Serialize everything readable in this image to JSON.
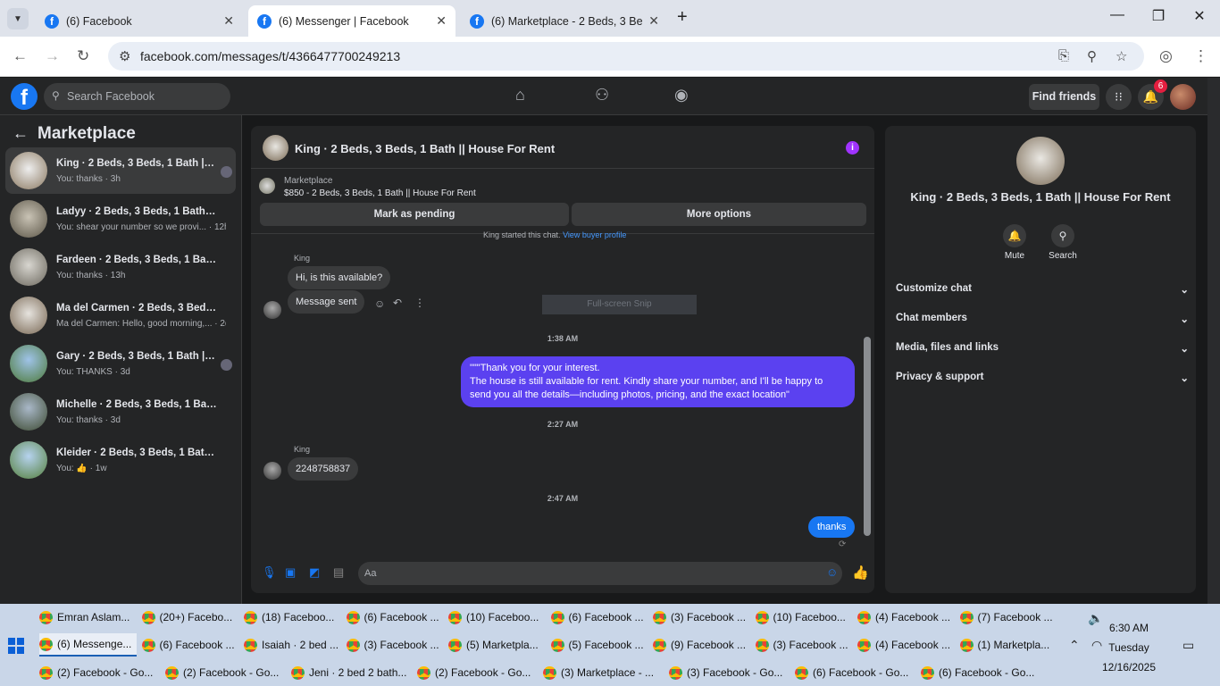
{
  "browser": {
    "tabs": [
      {
        "title": "(6) Facebook",
        "close": "✕"
      },
      {
        "title": "(6) Messenger | Facebook",
        "close": "✕"
      },
      {
        "title": "(6) Marketplace - 2 Beds, 3 Bed",
        "close": "✕"
      }
    ],
    "new_tab": "+",
    "url": "facebook.com/messages/t/4366477700249213"
  },
  "fb": {
    "logo": "f",
    "search_placeholder": "Search Facebook",
    "find_friends": "Find friends",
    "notif_count": "6"
  },
  "sidebar": {
    "title": "Marketplace",
    "conversations": [
      {
        "name": "King · 2 Beds, 3 Beds, 1 Bath || H...",
        "preview": "You: thanks · 3h"
      },
      {
        "name": "Ladyy · 2 Beds, 3 Beds, 1 Bath || Ho...",
        "preview": "You: shear your number so we provi... · 12h"
      },
      {
        "name": "Fardeen · 2 Beds, 3 Beds, 1 Bath || ...",
        "preview": "You: thanks · 13h"
      },
      {
        "name": "Ma del Carmen · 2 Beds, 3 Beds, 1 ...",
        "preview": "Ma del Carmen: Hello, good morning,... · 2d"
      },
      {
        "name": "Gary · 2 Beds, 3 Beds, 1 Bath || H...",
        "preview": "You: THANKS · 3d"
      },
      {
        "name": "Michelle · 2 Beds, 3 Beds, 1 Bath || ...",
        "preview": "You: thanks · 3d"
      },
      {
        "name": "Kleider · 2 Beds, 3 Beds, 1 Bath || H...",
        "preview": "You: 👍 · 1w"
      }
    ]
  },
  "chat": {
    "title": "King · 2 Beds, 3 Beds, 1 Bath || House For Rent",
    "marketplace_label": "Marketplace",
    "listing": "$850 - 2 Beds, 3 Beds, 1 Bath || House For Rent",
    "mark_pending": "Mark as pending",
    "more_options": "More options",
    "started_notice": "King started this chat.",
    "view_buyer": "View buyer profile",
    "sender1": "King",
    "msg1": "Hi, is this available?",
    "msg2": "Message sent",
    "snip_overlay": "Full-screen Snip",
    "time1": "1:38 AM",
    "reply_line1": "\"\"\"Thank you for your interest.",
    "reply_line2": "The house is still available for rent. Kindly share your number, and I'll be happy to",
    "reply_line3": "send you all the details—including photos, pricing, and the exact location\"",
    "time2": "2:27 AM",
    "sender2": "King",
    "msg3": "2248758837",
    "time3": "2:47 AM",
    "msg4": "thanks",
    "composer_placeholder": "Aa"
  },
  "info": {
    "title": "King · 2 Beds, 3 Beds, 1 Bath || House For Rent",
    "mute": "Mute",
    "search": "Search",
    "sections": [
      "Customize chat",
      "Chat members",
      "Media, files and links",
      "Privacy & support"
    ]
  },
  "taskbar": {
    "row1": [
      "Emran Aslam...",
      "(20+) Facebo...",
      "(18) Faceboo...",
      "(6) Facebook ...",
      "(10) Faceboo...",
      "(6) Facebook ...",
      "(3) Facebook ...",
      "(10) Faceboo...",
      "(4) Facebook ...",
      "(7) Facebook ..."
    ],
    "row2": [
      "(6) Messenge...",
      "(6) Facebook ...",
      "Isaiah · 2 bed ...",
      "(3) Facebook ...",
      "(5) Marketpla...",
      "(5) Facebook ...",
      "(9) Facebook ...",
      "(3) Facebook ...",
      "(4) Facebook ...",
      "(1) Marketpla..."
    ],
    "row3": [
      "(2) Facebook - Go...",
      "(2) Facebook - Go...",
      "Jeni · 2 bed 2 bath...",
      "(2) Facebook - Go...",
      "(3) Marketplace - ...",
      "(3) Facebook - Go...",
      "(6) Facebook - Go...",
      "(6) Facebook - Go..."
    ],
    "time": "6:30 AM",
    "day": "Tuesday",
    "date": "12/16/2025"
  },
  "colors": {
    "accent": "#1877f2",
    "outgoing": "#5b41f0",
    "bg": "#18191a",
    "panel": "#242526"
  }
}
